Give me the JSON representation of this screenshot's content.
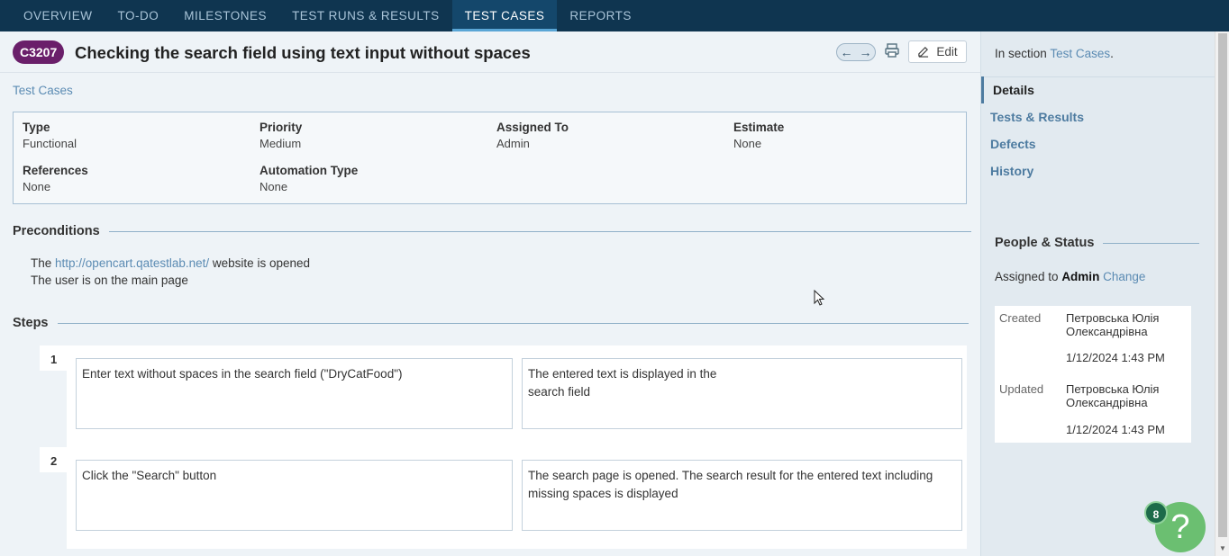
{
  "nav": {
    "tabs": [
      {
        "label": "OVERVIEW"
      },
      {
        "label": "TO-DO"
      },
      {
        "label": "MILESTONES"
      },
      {
        "label": "TEST RUNS & RESULTS"
      },
      {
        "label": "TEST CASES",
        "active": true
      },
      {
        "label": "REPORTS"
      }
    ]
  },
  "case": {
    "id": "C3207",
    "title": "Checking the search field using text input without spaces",
    "breadcrumb": "Test Cases",
    "edit_label": "Edit"
  },
  "props": {
    "type_label": "Type",
    "type_value": "Functional",
    "priority_label": "Priority",
    "priority_value": "Medium",
    "assigned_label": "Assigned To",
    "assigned_value": "Admin",
    "estimate_label": "Estimate",
    "estimate_value": "None",
    "references_label": "References",
    "references_value": "None",
    "automation_label": "Automation Type",
    "automation_value": "None"
  },
  "preconditions": {
    "heading": "Preconditions",
    "line1_prefix": "The",
    "line1_link": "http://opencart.qatestlab.net/",
    "line1_suffix": "website is opened",
    "line2": "The user is on the main page"
  },
  "steps": {
    "heading": "Steps",
    "items": [
      {
        "num": "1",
        "action": "Enter text without spaces in the search field (\"DryCatFood\")",
        "expected": "The entered text is displayed in the search field"
      },
      {
        "num": "2",
        "action": "Click the \"Search\" button",
        "expected": "The search page is opened. The search result for the entered text including missing spaces is displayed"
      }
    ]
  },
  "sidebar": {
    "section_prefix": "In section",
    "section_link": "Test Cases",
    "section_suffix": ".",
    "nav": [
      {
        "label": "Details",
        "active": true
      },
      {
        "label": "Tests & Results"
      },
      {
        "label": "Defects"
      },
      {
        "label": "History"
      }
    ],
    "people_heading": "People & Status",
    "assigned_prefix": "Assigned to",
    "assigned_name": "Admin",
    "change_label": "Change",
    "created_label": "Created",
    "created_by": "Петровська Юлія Олександрівна",
    "created_at": "1/12/2024 1:43 PM",
    "updated_label": "Updated",
    "updated_by": "Петровська Юлія Олександрівна",
    "updated_at": "1/12/2024 1:43 PM"
  },
  "help": {
    "badge_count": "8",
    "icon": "?"
  },
  "colors": {
    "nav_bg": "#0f3550",
    "case_badge": "#6a1f6a",
    "link": "#5b8bb3",
    "help_green": "#6bbf71"
  }
}
